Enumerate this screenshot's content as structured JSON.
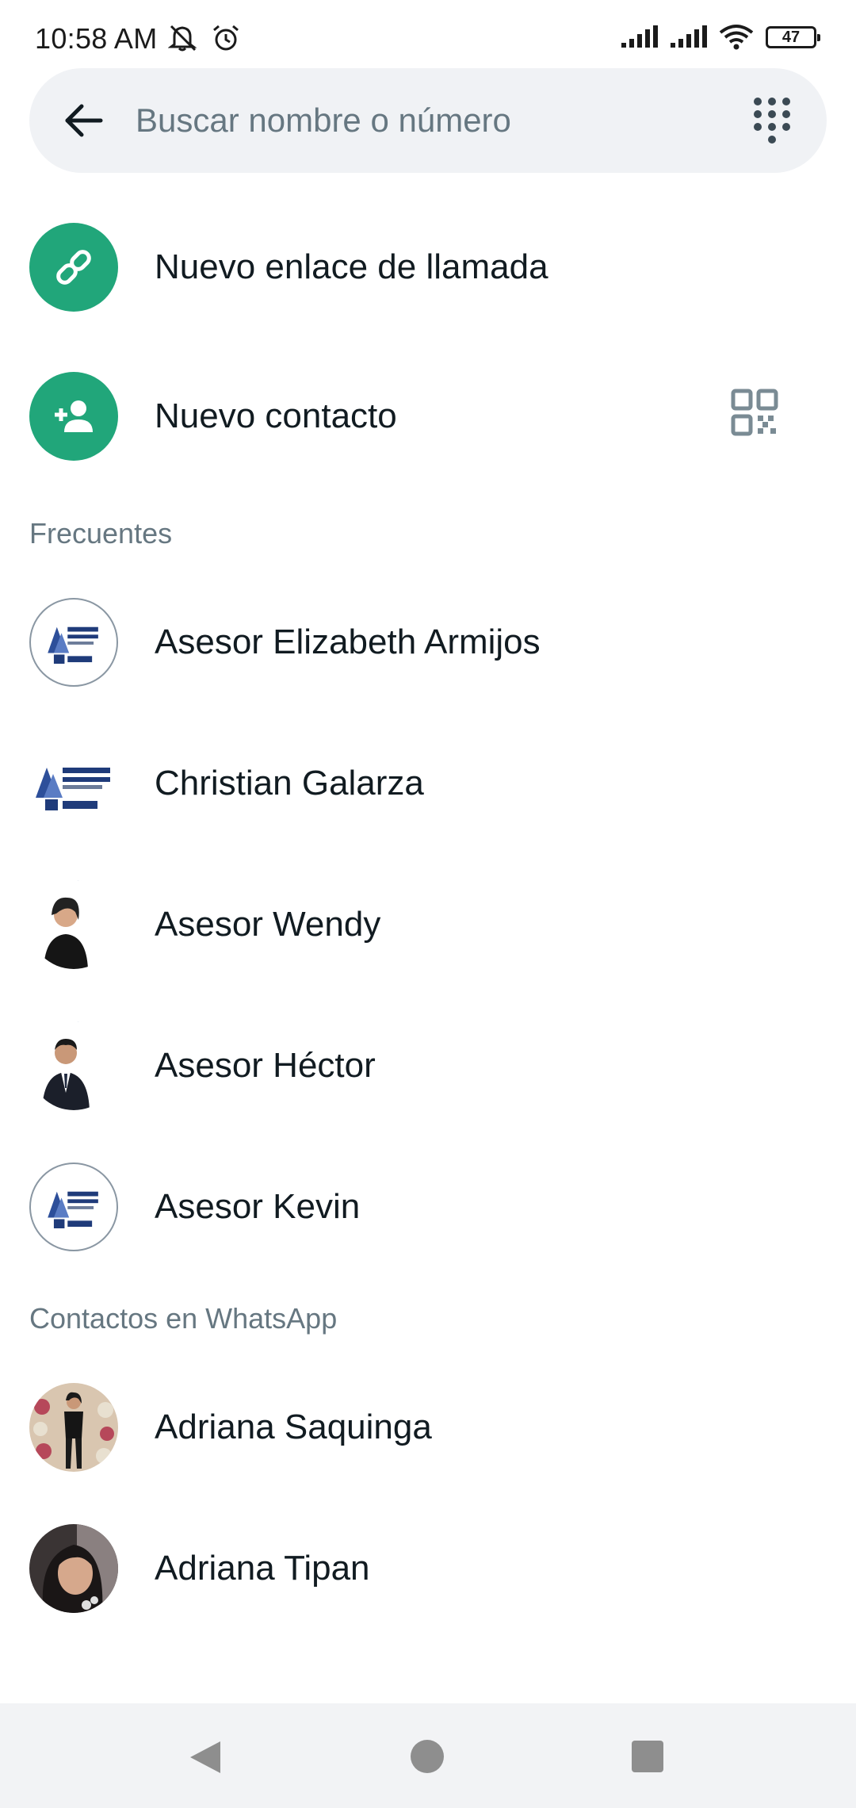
{
  "status_bar": {
    "time": "10:58 AM",
    "battery": "47",
    "icons": [
      "muted-notifications-icon",
      "alarm-icon",
      "signal-icon",
      "signal-icon",
      "wifi-icon",
      "battery-icon"
    ]
  },
  "search": {
    "placeholder": "Buscar nombre o número",
    "value": ""
  },
  "actions": {
    "new_call_link": "Nuevo enlace de llamada",
    "new_contact": "Nuevo contacto"
  },
  "sections": {
    "frequent": "Frecuentes",
    "whatsapp_contacts": "Contactos en WhatsApp"
  },
  "frequent_contacts": [
    {
      "name": "Asesor Elizabeth Armijos",
      "avatar": "global-english-logo"
    },
    {
      "name": "Christian Galarza",
      "avatar": "global-english-logo"
    },
    {
      "name": "Asesor Wendy",
      "avatar": "person-photo"
    },
    {
      "name": "Asesor Héctor",
      "avatar": "person-photo"
    },
    {
      "name": "Asesor Kevin",
      "avatar": "global-english-logo"
    }
  ],
  "whatsapp_contacts": [
    {
      "name": "Adriana Saquinga",
      "avatar": "person-photo"
    },
    {
      "name": "Adriana Tipan",
      "avatar": "person-photo"
    }
  ],
  "colors": {
    "accent": "#21a67a",
    "text_primary": "#111b21",
    "text_secondary": "#667781",
    "search_background": "#f0f2f5"
  }
}
